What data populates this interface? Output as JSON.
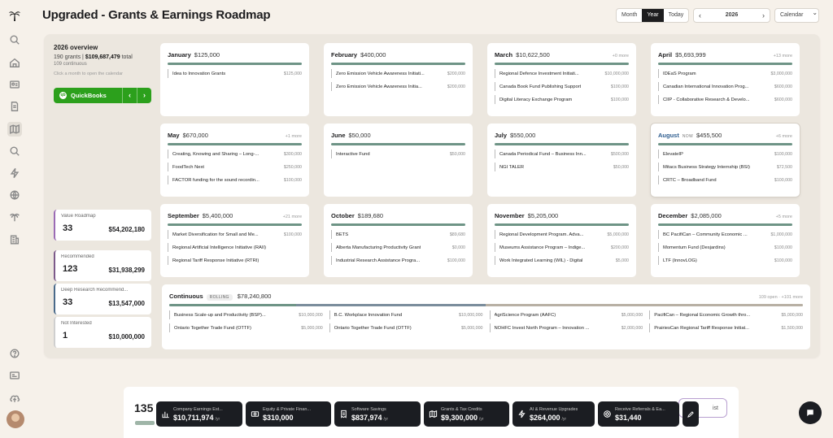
{
  "header": {
    "title": "Upgraded - Grants & Earnings Roadmap",
    "views": [
      "Month",
      "Year"
    ],
    "active_view": "Year",
    "today_label": "Today",
    "prev_glyph": "‹",
    "next_glyph": "›",
    "year": "2026",
    "mode_select": "Calendar",
    "mode_chevron": "⌄"
  },
  "sidebar": {
    "icons": [
      "palm-logo-icon",
      "search-icon",
      "home-icon",
      "id-card-icon",
      "document-icon",
      "map-icon",
      "search-icon",
      "lightning-icon",
      "globe-icon",
      "palm-tree-icon",
      "building-icon",
      "help-icon",
      "card-icon",
      "cloud-upload-icon"
    ],
    "active": "map-icon"
  },
  "overview": {
    "heading": "2026 overview",
    "grants": "190 grants",
    "sep": " | ",
    "total": "$109,687,479",
    "total_suffix": " total",
    "continuous": "109 continuous",
    "hint": "Click a month to open the calendar"
  },
  "quickbooks": {
    "label": "QuickBooks",
    "logo": "qb",
    "prev": "‹",
    "next": "›"
  },
  "stats": [
    {
      "label": "Value Roadmap",
      "count": "33",
      "value": "$54,202,180",
      "color": "#9b6bb5"
    },
    {
      "label": "Recommended",
      "count": "123",
      "value": "$31,938,299",
      "color": "#7c5a8a"
    },
    {
      "label": "Deep Research Recommend...",
      "count": "33",
      "value": "$13,547,000",
      "color": "#4a6a8a"
    },
    {
      "label": "Not Interested",
      "count": "1",
      "value": "$10,000,000",
      "color": "#cfcfcf"
    }
  ],
  "months": [
    {
      "name": "January",
      "amount": "$125,000",
      "more": "",
      "now": "",
      "bar_color": "#6e9486",
      "items": [
        {
          "name": "Idea to Innovation Grants",
          "amount": "$125,000"
        }
      ]
    },
    {
      "name": "February",
      "amount": "$400,000",
      "more": "",
      "now": "",
      "bar_color": "#6e9486",
      "items": [
        {
          "name": "Zero Emission Vehicle Awareness Initiati...",
          "amount": "$200,000"
        },
        {
          "name": "Zero Emission Vehicle Awareness Initia...",
          "amount": "$200,000"
        }
      ]
    },
    {
      "name": "March",
      "amount": "$10,622,500",
      "more": "+0 more",
      "now": "",
      "bar_color": "#6e9486",
      "items": [
        {
          "name": "Regional Defence Investment Initiati...",
          "amount": "$10,000,000"
        },
        {
          "name": "Canada Book Fund Publishing Support",
          "amount": "$100,000"
        },
        {
          "name": "Digital Literacy Exchange Program",
          "amount": "$100,000"
        }
      ]
    },
    {
      "name": "April",
      "amount": "$5,693,999",
      "more": "+13 more",
      "now": "",
      "bar_color": "#6e9486",
      "items": [
        {
          "name": "IDEaS Program",
          "amount": "$3,000,000"
        },
        {
          "name": "Canadian International Innovation Prog...",
          "amount": "$600,000"
        },
        {
          "name": "CIIP - Collaborative Research & Develo...",
          "amount": "$600,000"
        }
      ]
    },
    {
      "name": "May",
      "amount": "$670,000",
      "more": "+1 more",
      "now": "",
      "bar_color": "#6e9486",
      "items": [
        {
          "name": "Creating, Knowing and Sharing – Long-...",
          "amount": "$300,000"
        },
        {
          "name": "FoodTech Next",
          "amount": "$250,000"
        },
        {
          "name": "FACTOR funding for the sound recordin...",
          "amount": "$100,000"
        }
      ]
    },
    {
      "name": "June",
      "amount": "$50,000",
      "more": "",
      "now": "",
      "bar_color": "#6e9486",
      "items": [
        {
          "name": "Interactive Fund",
          "amount": "$50,000"
        }
      ]
    },
    {
      "name": "July",
      "amount": "$550,000",
      "more": "",
      "now": "",
      "bar_color": "#6e9486",
      "items": [
        {
          "name": "Canada Periodical Fund – Business Inn...",
          "amount": "$500,000"
        },
        {
          "name": "NGI TALER",
          "amount": "$50,000"
        }
      ]
    },
    {
      "name": "August",
      "amount": "$455,500",
      "more": "+6 more",
      "now": "NOW",
      "bar_color": "#6e9486",
      "items": [
        {
          "name": "ElevateIP",
          "amount": "$100,000"
        },
        {
          "name": "Mitacs Business Strategy Internship (BSI)",
          "amount": "$72,500"
        },
        {
          "name": "CRTC – Broadband Fund",
          "amount": "$100,000"
        }
      ]
    },
    {
      "name": "September",
      "amount": "$5,400,000",
      "more": "+21 more",
      "now": "",
      "bar_color": "#6e9486",
      "items": [
        {
          "name": "Market Diversification for Small and Me...",
          "amount": "$100,000"
        },
        {
          "name": "Regional Artificial Intelligence Initiative (RAII)",
          "amount": ""
        },
        {
          "name": "Regional Tariff Response Initiative (RTRI)",
          "amount": ""
        }
      ]
    },
    {
      "name": "October",
      "amount": "$189,680",
      "more": "",
      "now": "",
      "bar_color": "#6e9486",
      "items": [
        {
          "name": "BETS",
          "amount": "$89,680"
        },
        {
          "name": "Alberta Manufacturing Productivity Grant",
          "amount": "$0,000"
        },
        {
          "name": "Industrial Research Assistance Progra...",
          "amount": "$100,000"
        }
      ]
    },
    {
      "name": "November",
      "amount": "$5,205,000",
      "more": "",
      "now": "",
      "bar_color": "#6e9486",
      "items": [
        {
          "name": "Regional Development Program. Adva...",
          "amount": "$5,000,000"
        },
        {
          "name": "Museums Assistance Program – Indige...",
          "amount": "$200,000"
        },
        {
          "name": "Work Integrated Learning (WIL) - Digital",
          "amount": "$5,000"
        }
      ]
    },
    {
      "name": "December",
      "amount": "$2,085,000",
      "more": "+5 more",
      "now": "",
      "bar_color": "#6e9486",
      "items": [
        {
          "name": "BC PacifiCan – Community Economic ...",
          "amount": "$1,000,000"
        },
        {
          "name": "Momentum Fund (Desjardins)",
          "amount": "$100,000"
        },
        {
          "name": "LTF (InnovLOG)",
          "amount": "$100,000"
        }
      ]
    }
  ],
  "continuous": {
    "name": "Continuous",
    "badge": "ROLLING",
    "amount": "$78,240,800",
    "more": "109 open · +101 more",
    "items": [
      {
        "name": "Business Scale-up and Productivity (BSP)...",
        "amount": "$10,000,000"
      },
      {
        "name": "B.C. Workplace Innovation Fund",
        "amount": "$10,000,000"
      },
      {
        "name": "AgriScience Program (AAFC)",
        "amount": "$5,000,000"
      },
      {
        "name": "PacifiCan – Regional Economic Growth thro...",
        "amount": "$5,000,000"
      },
      {
        "name": "Ontario Together Trade Fund (OTTF)",
        "amount": "$5,000,000"
      },
      {
        "name": "Ontario Together Trade Fund (OTTF)",
        "amount": "$5,000,000"
      },
      {
        "name": "NOHFC Invest North Program – Innovation ...",
        "amount": "$2,000,000"
      },
      {
        "name": "PrairiesCan Regional Tariff Response Initiat...",
        "amount": "$1,500,000"
      }
    ]
  },
  "footer": {
    "count": "135",
    "list_label": "ist",
    "progress_fraction": 0.2
  },
  "dock": [
    {
      "icon": "bar-chart-icon",
      "label": "Company Earnings Est...",
      "value": "$10,711,974",
      "unit": "/yr"
    },
    {
      "icon": "bank-note-icon",
      "label": "Equity & Private Finan...",
      "value": "$310,000",
      "unit": ""
    },
    {
      "icon": "receipt-icon",
      "label": "Software Savings",
      "value": "$837,974",
      "unit": "/yr"
    },
    {
      "icon": "map-icon",
      "label": "Grants & Tax Credits",
      "value": "$9,300,000",
      "unit": "/yr"
    },
    {
      "icon": "lightning-icon",
      "label": "AI & Revenue Upgrades",
      "value": "$264,000",
      "unit": "/yr"
    },
    {
      "icon": "referral-icon",
      "label": "Receive Referrals & Ea...",
      "value": "$31,440",
      "unit": ""
    }
  ]
}
